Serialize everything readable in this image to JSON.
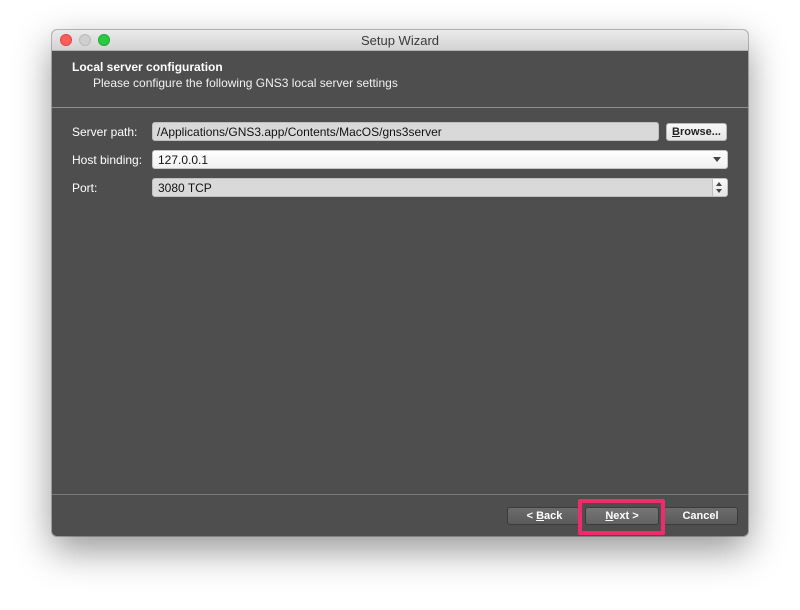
{
  "window": {
    "title": "Setup Wizard"
  },
  "header": {
    "title": "Local server configuration",
    "subtitle": "Please configure the following GNS3 local server settings"
  },
  "form": {
    "server_path": {
      "label": "Server path:",
      "value": "/Applications/GNS3.app/Contents/MacOS/gns3server",
      "browse_prefix": "",
      "browse_mnemonic": "B",
      "browse_rest": "rowse..."
    },
    "host_binding": {
      "label": "Host binding:",
      "value": "127.0.0.1"
    },
    "port": {
      "label": "Port:",
      "value": "3080 TCP"
    }
  },
  "buttons": {
    "back_prefix": "< ",
    "back_mnemonic": "B",
    "back_rest": "ack",
    "next_mnemonic": "N",
    "next_rest": "ext >",
    "cancel": "Cancel"
  },
  "colors": {
    "dialog_bg": "#4e4e4e",
    "highlight": "#f02b6c"
  },
  "icons": {
    "close": "traffic-light-close",
    "minimize": "traffic-light-minimize",
    "maximize": "traffic-light-maximize",
    "dropdown": "chevron-down-icon",
    "spinner": "spinner-arrows-icon"
  }
}
